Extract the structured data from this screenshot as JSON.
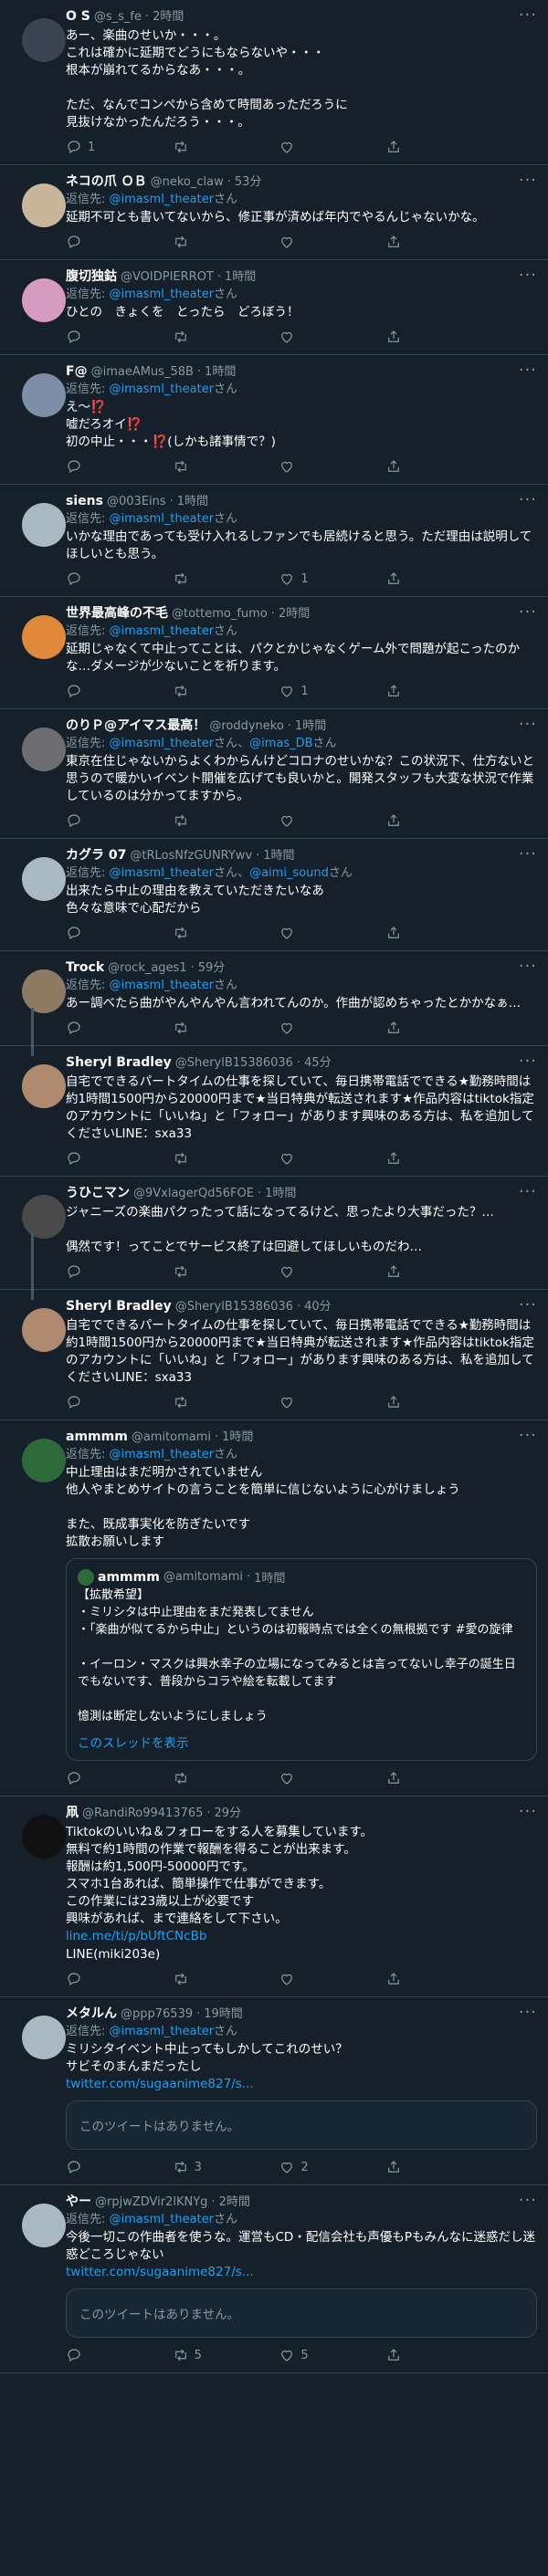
{
  "labels": {
    "reply_prefix": "返信先: ",
    "san": "さん",
    "and": "、",
    "show_thread": "このスレッドを表示",
    "unavailable": "このツイートはありません。"
  },
  "colors": {
    "background": "#15202b",
    "text": "#ffffff",
    "muted": "#8899a6",
    "accent": "#1da1f2",
    "border": "#38444d"
  },
  "icons": [
    "reply-icon",
    "retweet-icon",
    "like-icon",
    "share-icon",
    "more-icon"
  ],
  "tweets": [
    {
      "name": "O S",
      "handle": "@s_s_fe",
      "time": "2時間",
      "reply_to": [],
      "text": "あー、楽曲のせいか・・・。\nこれは確かに延期でどうにもならないや・・・\n根本が崩れてるからなあ・・・。\n\nただ、なんでコンペから含めて時間あっただろうに\n見抜けなかったんだろう・・・。",
      "replies": "1",
      "retweets": "",
      "likes": "",
      "avatar_color": "#3a4350"
    },
    {
      "name": "ネコの爪 ＯＢ",
      "handle": "@neko_claw",
      "time": "53分",
      "reply_to": [
        "@imasml_theater"
      ],
      "text": "延期不可とも書いてないから、修正事が済めば年内でやるんじゃないかな。",
      "replies": "",
      "retweets": "",
      "likes": "",
      "avatar_color": "#c9b59a"
    },
    {
      "name": "腹切独鈷",
      "handle": "@VOIDPIERROT",
      "time": "1時間",
      "reply_to": [
        "@imasml_theater"
      ],
      "text": "ひとの　きょくを　とったら　どろぼう！",
      "replies": "",
      "retweets": "",
      "likes": "",
      "avatar_color": "#d79bbf"
    },
    {
      "name": "F@",
      "handle": "@imaeAMus_58B",
      "time": "1時間",
      "reply_to": [
        "@imasml_theater"
      ],
      "text": "え〜⁉️\n嘘だろオイ⁉️\n初の中止・・・⁉️(しかも諸事情で？)",
      "replies": "",
      "retweets": "",
      "likes": "",
      "avatar_color": "#7d8fa6"
    },
    {
      "name": "siens",
      "handle": "@003Eins",
      "time": "1時間",
      "reply_to": [
        "@imasml_theater"
      ],
      "text": "いかな理由であっても受け入れるしファンでも居続けると思う。ただ理由は説明してほしいとも思う。",
      "replies": "",
      "retweets": "",
      "likes": "1",
      "avatar_color": "#aab8c2"
    },
    {
      "name": "世界最高峰の不毛",
      "handle": "@tottemo_fumo",
      "time": "2時間",
      "reply_to": [
        "@imasml_theater"
      ],
      "text": "延期じゃなくて中止ってことは、パクとかじゃなくゲーム外で問題が起こったのかな…ダメージが少ないことを祈ります。",
      "replies": "",
      "retweets": "",
      "likes": "1",
      "avatar_color": "#e0893a"
    },
    {
      "name": "のりＰ@アイマス最高！",
      "handle": "@roddyneko",
      "time": "1時間",
      "reply_to": [
        "@imasml_theater",
        "@imas_DB"
      ],
      "text": "東京在住じゃないからよくわからんけどコロナのせいかな？この状況下、仕方ないと思うので暖かいイベント開催を広げても良いかと。開発スタッフも大変な状況で作業しているのは分かってますから。",
      "replies": "",
      "retweets": "",
      "likes": "",
      "avatar_color": "#6e6e70"
    },
    {
      "name": "カグラ 07",
      "handle": "@tRLosNfzGUNRYwv",
      "time": "1時間",
      "reply_to": [
        "@imasml_theater",
        "@aimi_sound"
      ],
      "text": "出来たら中止の理由を教えていただきたいなあ\n色々な意味で心配だから",
      "replies": "",
      "retweets": "",
      "likes": "",
      "avatar_color": "#aab8c2"
    },
    {
      "name": "Trock",
      "handle": "@rock_ages1",
      "time": "59分",
      "reply_to": [
        "@imasml_theater"
      ],
      "text": "あー調べたら曲がやんやんやん言われてんのか。作曲が認めちゃったとかかなぁ…",
      "replies": "",
      "retweets": "",
      "likes": "",
      "avatar_color": "#8c7a62",
      "thread": true
    },
    {
      "name": "Sheryl Bradley",
      "handle": "@SherylB15386036",
      "time": "45分",
      "reply_to": [],
      "text": "自宅でできるパートタイムの仕事を探していて、毎日携帯電話でできる★勤務時間は約1時間1500円から20000円まで★当日特典が転送されます★作品内容はtiktok指定のアカウントに「いいね」と「フォロー」があります興味のある方は、私を追加してくださいLINE：sxa33",
      "replies": "",
      "retweets": "",
      "likes": "",
      "avatar_color": "#b08a6e"
    },
    {
      "name": "うひこマン",
      "handle": "@9VxlagerQd56FOE",
      "time": "1時間",
      "reply_to": [],
      "text": "ジャニーズの楽曲パクったって話になってるけど、思ったより大事だった？…\n\n偶然です！ってことでサービス終了は回避してほしいものだわ…",
      "replies": "",
      "retweets": "",
      "likes": "",
      "avatar_color": "#4a4a4a",
      "thread": true
    },
    {
      "name": "Sheryl Bradley",
      "handle": "@SherylB15386036",
      "time": "40分",
      "reply_to": [],
      "text": "自宅でできるパートタイムの仕事を探していて、毎日携帯電話でできる★勤務時間は約1時間1500円から20000円まで★当日特典が転送されます★作品内容はtiktok指定のアカウントに「いいね」と「フォロー」があります興味のある方は、私を追加してくださいLINE：sxa33",
      "replies": "",
      "retweets": "",
      "likes": "",
      "avatar_color": "#b08a6e"
    },
    {
      "name": "ammmm",
      "handle": "@amitomami",
      "time": "1時間",
      "reply_to": [
        "@imasml_theater"
      ],
      "text": "中止理由はまだ明かされていません\n他人やまとめサイトの言うことを簡単に信じないように心がけましょう\n\nまた、既成事実化を防ぎたいです\n拡散お願いします",
      "replies": "",
      "retweets": "",
      "likes": "",
      "avatar_color": "#2e6b3a",
      "quote": {
        "name": "ammmm",
        "handle": "@amitomami",
        "time": "1時間",
        "text": "【拡散希望】\n・ミリシタは中止理由をまだ発表してません\n・「楽曲が似てるから中止」というのは初報時点では全くの無根拠です #愛の旋律\n\n・イーロン・マスクは興水幸子の立場になってみるとは言ってないし幸子の誕生日でもないです、普段からコラや絵を転載してます\n\n憶測は断定しないようにしましょう",
        "show_thread": true
      }
    },
    {
      "name": "凧",
      "handle": "@RandiRo99413765",
      "time": "29分",
      "reply_to": [],
      "text": "Tiktokのいいね＆フォローをする人を募集しています。\n無料で約1時間の作業で報酬を得ることが出来ます。\n報酬は約1,500円-50000円です。\nスマホ1台あれば、簡単操作で仕事ができます。\nこの作業には23歳以上が必要です\n興味があれば、まで連絡をして下さい。",
      "link": "line.me/ti/p/bUftCNcBb",
      "text2": "LINE(miki203e)",
      "replies": "",
      "retweets": "",
      "likes": "",
      "avatar_color": "#111111"
    },
    {
      "name": "メタルん",
      "handle": "@ppp76539",
      "time": "19時間",
      "reply_to": [
        "@imasml_theater"
      ],
      "text": "ミリシタイベント中止ってもしかしてこれのせい？\nサビそのまんまだったし",
      "link": "twitter.com/sugaanime827/s...",
      "unavailable": true,
      "replies": "",
      "retweets": "3",
      "likes": "2",
      "avatar_color": "#aab8c2"
    },
    {
      "name": "やー",
      "handle": "@rpjwZDVir2lKNYg",
      "time": "2時間",
      "reply_to": [
        "@imasml_theater"
      ],
      "text": "今後一切この作曲者を使うな。運営もCD・配信会社も声優もPもみんなに迷惑だし迷惑どころじゃない",
      "link": "twitter.com/sugaanime827/s...",
      "unavailable": true,
      "replies": "",
      "retweets": "5",
      "likes": "5",
      "avatar_color": "#aab8c2"
    }
  ]
}
